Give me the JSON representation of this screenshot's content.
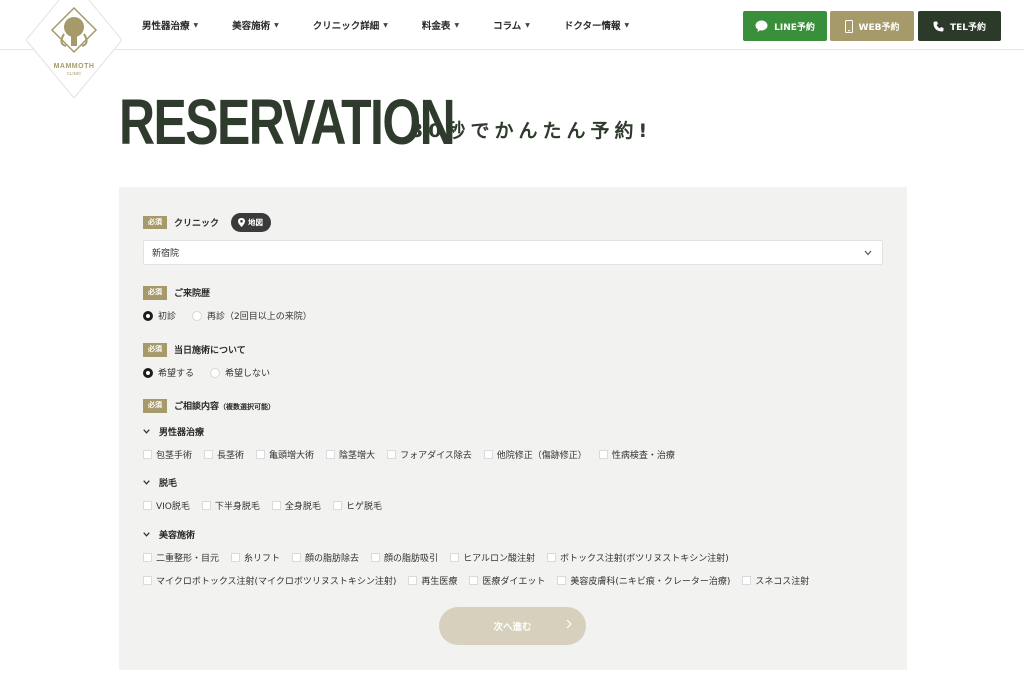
{
  "brand": {
    "name": "MAMMOTH",
    "sub": "CLINIC"
  },
  "nav": [
    {
      "label": "男性器治療"
    },
    {
      "label": "美容施術"
    },
    {
      "label": "クリニック詳細"
    },
    {
      "label": "料金表"
    },
    {
      "label": "コラム"
    },
    {
      "label": "ドクター情報"
    }
  ],
  "header_buttons": {
    "line": "LINE予約",
    "web": "WEB予約",
    "tel": "TEL予約"
  },
  "title": {
    "main": "RESERVATION",
    "sub": "30秒でかんたん予約!"
  },
  "form": {
    "required_badge": "必須",
    "clinic": {
      "label": "クリニック",
      "map": "地図",
      "selected": "新宿院"
    },
    "visit": {
      "label": "ご来院歴",
      "options": [
        "初診",
        "再診（2回目以上の来院）"
      ],
      "selected_index": 0
    },
    "same_day": {
      "label": "当日施術について",
      "options": [
        "希望する",
        "希望しない"
      ],
      "selected_index": 0
    },
    "consult": {
      "label": "ご相談内容",
      "note": "（複数選択可能）"
    },
    "categories": [
      {
        "name": "男性器治療",
        "items": [
          [
            "包茎手術",
            "長茎術",
            "亀頭増大術",
            "陰茎増大",
            "フォアダイス除去",
            "他院修正（傷跡修正）",
            "性病検査・治療"
          ]
        ]
      },
      {
        "name": "脱毛",
        "items": [
          [
            "VIO脱毛",
            "下半身脱毛",
            "全身脱毛",
            "ヒゲ脱毛"
          ]
        ]
      },
      {
        "name": "美容施術",
        "items": [
          [
            "二重整形・目元",
            "糸リフト",
            "顔の脂肪除去",
            "顔の脂肪吸引",
            "ヒアルロン酸注射",
            "ボトックス注射(ボツリヌストキシン注射)"
          ],
          [
            "マイクロボトックス注射(マイクロボツリヌストキシン注射)",
            "再生医療",
            "医療ダイエット",
            "美容皮膚科(ニキビ痕・クレーター治療)",
            "スネコス注射"
          ]
        ]
      }
    ],
    "next_button": "次へ進む"
  },
  "colors": {
    "accent": "#a79a6a",
    "dark": "#2f3b2d",
    "line": "#3a8f3b"
  }
}
